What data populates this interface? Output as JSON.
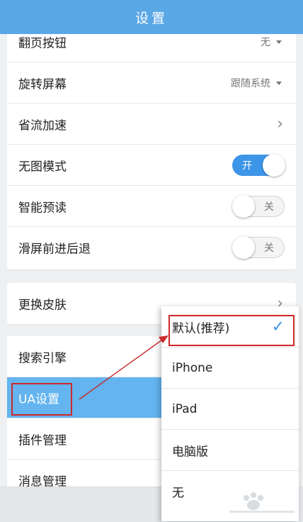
{
  "header": {
    "title": "设置"
  },
  "settings_group1": [
    {
      "label": "翻页按钮",
      "value": "无"
    },
    {
      "label": "旋转屏幕",
      "value": "跟随系统"
    },
    {
      "label": "省流加速"
    },
    {
      "label": "无图模式",
      "toggle": "开"
    },
    {
      "label": "智能预读",
      "toggle": "关"
    },
    {
      "label": "滑屏前进后退",
      "toggle": "关"
    }
  ],
  "settings_group2": [
    {
      "label": "更换皮肤"
    }
  ],
  "settings_group3": [
    {
      "label": "搜索引擎"
    },
    {
      "label": "UA设置"
    },
    {
      "label": "插件管理"
    },
    {
      "label": "消息管理"
    }
  ],
  "ua_dropdown": {
    "options": [
      "默认(推荐)",
      "iPhone",
      "iPad",
      "电脑版",
      "无"
    ],
    "selected_index": 0
  },
  "icons": {
    "chevron": "chevron-right-icon",
    "caret": "caret-down-icon",
    "check": "check-icon"
  },
  "colors": {
    "header": "#5aa7e6",
    "toggle_on": "#3d95e8",
    "highlight": "#63b4ef",
    "annotation": "#d02828"
  }
}
